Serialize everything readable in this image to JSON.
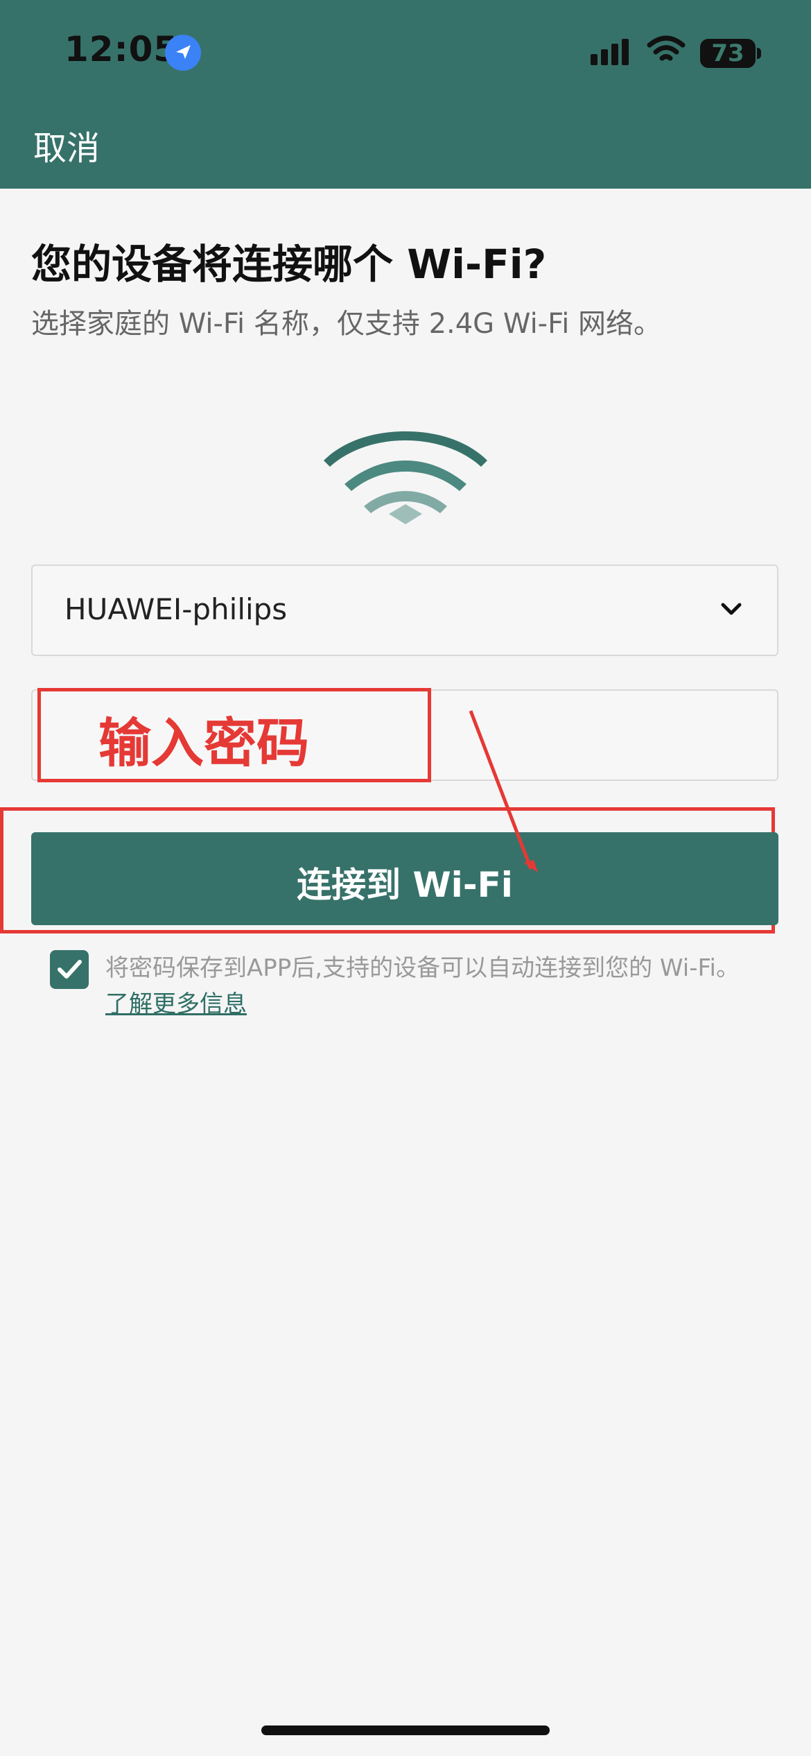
{
  "status_bar": {
    "time": "12:05",
    "battery": "73",
    "icons": [
      "location-icon",
      "signal-icon",
      "wifi-icon",
      "battery-icon"
    ]
  },
  "header": {
    "cancel": "取消"
  },
  "main": {
    "title": "您的设备将连接哪个 Wi-Fi?",
    "subtitle": "选择家庭的 Wi-Fi 名称，仅支持 2.4G Wi-Fi 网络。",
    "ssid_value": "HUAWEI-philips",
    "password_value": "",
    "connect_button": "连接到 Wi-Fi",
    "note_text": "将密码保存到APP后,支持的设备可以自动连接到您的 Wi-Fi。",
    "note_link": "了解更多信息"
  },
  "annotation": {
    "label": "输入密码"
  },
  "colors": {
    "accent": "#37726a",
    "annotation_red": "#e53935"
  }
}
